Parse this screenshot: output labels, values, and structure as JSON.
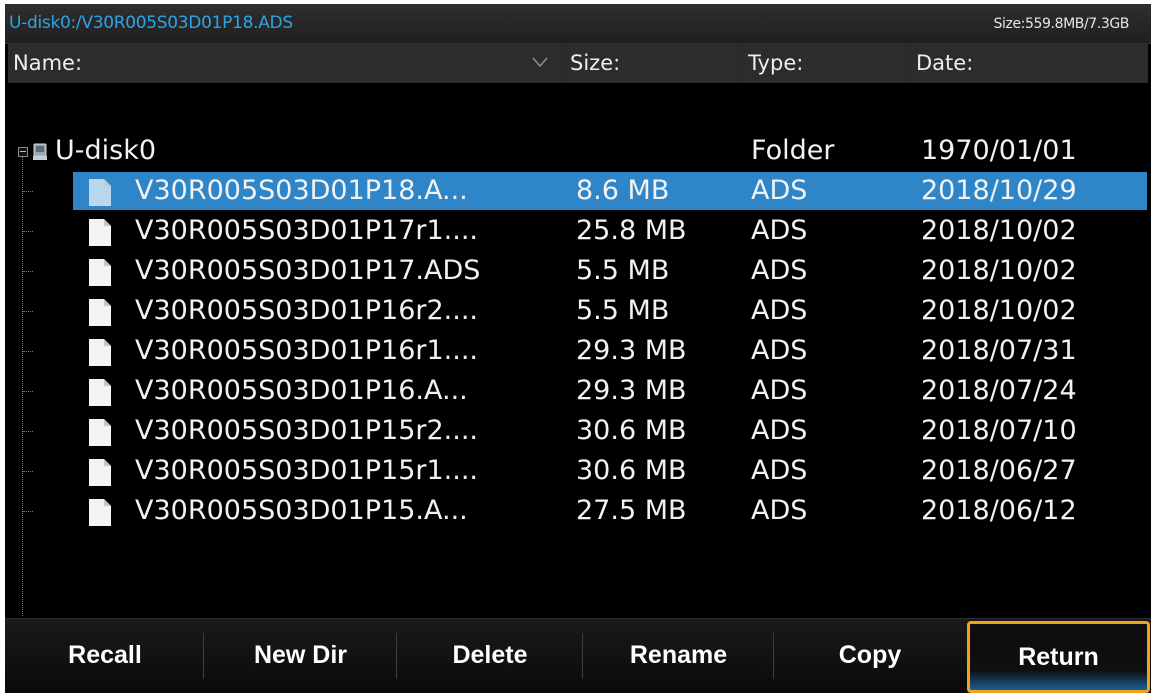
{
  "path_bar": {
    "path": "U-disk0:/V30R005S03D01P18.ADS",
    "size": "Size:559.8MB/7.3GB"
  },
  "columns": {
    "name": "Name:",
    "size": "Size:",
    "type": "Type:",
    "date": "Date:"
  },
  "root": {
    "name": "U-disk0",
    "type": "Folder",
    "date": "1970/01/01"
  },
  "files": [
    {
      "name": "V30R005S03D01P18.A...",
      "size": "8.6 MB",
      "type": "ADS",
      "date": "2018/10/29",
      "selected": true
    },
    {
      "name": "V30R005S03D01P17r1....",
      "size": "25.8 MB",
      "type": "ADS",
      "date": "2018/10/02"
    },
    {
      "name": "V30R005S03D01P17.ADS",
      "size": "5.5 MB",
      "type": "ADS",
      "date": "2018/10/02"
    },
    {
      "name": "V30R005S03D01P16r2....",
      "size": "5.5 MB",
      "type": "ADS",
      "date": "2018/10/02"
    },
    {
      "name": "V30R005S03D01P16r1....",
      "size": "29.3 MB",
      "type": "ADS",
      "date": "2018/07/31"
    },
    {
      "name": "V30R005S03D01P16.A...",
      "size": "29.3 MB",
      "type": "ADS",
      "date": "2018/07/24"
    },
    {
      "name": "V30R005S03D01P15r2....",
      "size": "30.6 MB",
      "type": "ADS",
      "date": "2018/07/10"
    },
    {
      "name": "V30R005S03D01P15r1....",
      "size": "30.6 MB",
      "type": "ADS",
      "date": "2018/06/27"
    },
    {
      "name": "V30R005S03D01P15.A...",
      "size": "27.5 MB",
      "type": "ADS",
      "date": "2018/06/12"
    }
  ],
  "toolbar": {
    "recall": "Recall",
    "new_dir": "New Dir",
    "delete": "Delete",
    "rename": "Rename",
    "copy": "Copy",
    "return": "Return"
  },
  "colors": {
    "path_text": "#2ea3e6",
    "selection": "#2e86c9",
    "focus_border": "#f0a21e"
  },
  "icons": {
    "sort": "chevron-down-icon",
    "expand": "tree-collapse-icon",
    "disk": "usb-disk-icon",
    "file": "file-icon"
  }
}
